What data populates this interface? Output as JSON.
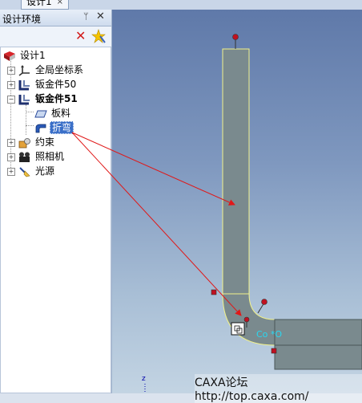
{
  "document_tab": {
    "title": "设计1",
    "close": "×"
  },
  "panel": {
    "title": "设计环境",
    "pin": "ᛘ",
    "close": "✕",
    "toolbar": {
      "delete": "✕"
    }
  },
  "tree": {
    "root": "设计1",
    "items": {
      "coord": "全局坐标系",
      "sheet50": "钣金件50",
      "sheet51": "钣金件51",
      "plate": "板料",
      "bend": "折弯",
      "constraint": "约束",
      "camera": "照相机",
      "light": "光源"
    },
    "expand_plus": "+",
    "expand_minus": "−"
  },
  "viewport": {
    "co_label": "Co *O",
    "axis_label": "z",
    "watermark": "CAXA论坛 http://top.caxa.com/"
  },
  "colors": {
    "part_fill": "#7a8a8e",
    "part_edge": "#f2f28a",
    "handle": "#c01020",
    "arrow": "#e01818",
    "selection": "#3a6fc8"
  }
}
